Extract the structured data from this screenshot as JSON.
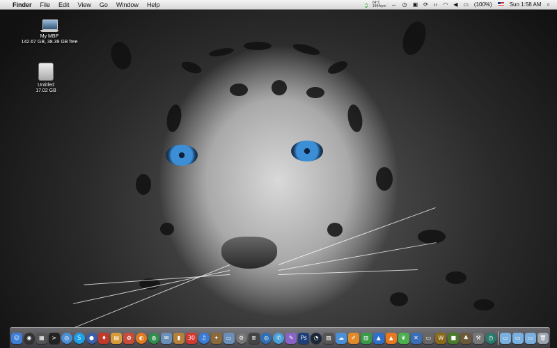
{
  "menubar": {
    "apple_glyph": "",
    "app_name": "Finder",
    "menus": [
      "File",
      "Edit",
      "View",
      "Go",
      "Window",
      "Help"
    ],
    "temperature": "64°C",
    "fan_speed": "1994rpm",
    "battery": "(100%)",
    "clock": "Sun 1:58 AM"
  },
  "desktop_icons": [
    {
      "name": "My MBP",
      "detail": "142.67 GB, 38.39 GB free",
      "icon": "laptop-icon"
    },
    {
      "name": "Untitled",
      "detail": "17.02 GB",
      "icon": "hard-drive-icon"
    }
  ],
  "dock": {
    "items": [
      {
        "icon": "finder-icon",
        "glyph": "☺",
        "color": "#3d7fd6"
      },
      {
        "icon": "dashboard-icon",
        "glyph": "◉",
        "color": "#333333",
        "round": true
      },
      {
        "icon": "mission-control-icon",
        "glyph": "▦",
        "color": "#555555"
      },
      {
        "icon": "terminal-icon",
        "glyph": ">",
        "color": "#222222"
      },
      {
        "icon": "safari-icon",
        "glyph": "◎",
        "color": "#4a8fd6",
        "round": true
      },
      {
        "icon": "skype-icon",
        "glyph": "S",
        "color": "#1ea0e8",
        "round": true
      },
      {
        "icon": "network-icon",
        "glyph": "●",
        "color": "#3a5fa8",
        "round": true
      },
      {
        "icon": "app-store-icon",
        "glyph": "♦",
        "color": "#c0392b"
      },
      {
        "icon": "preview-icon",
        "glyph": "▤",
        "color": "#d89b3a"
      },
      {
        "icon": "photos-icon",
        "glyph": "✿",
        "color": "#c94c3a"
      },
      {
        "icon": "firefox-icon",
        "glyph": "◐",
        "color": "#e37a1f",
        "round": true
      },
      {
        "icon": "chrome-icon",
        "glyph": "◍",
        "color": "#2f8f4e",
        "round": true
      },
      {
        "icon": "mail-icon",
        "glyph": "✉",
        "color": "#6a8fb8"
      },
      {
        "icon": "addressbook-icon",
        "glyph": "▮",
        "color": "#b5803a"
      },
      {
        "icon": "calendar-icon",
        "glyph": "30",
        "color": "#d33a2f"
      },
      {
        "icon": "itunes-icon",
        "glyph": "♫",
        "color": "#3a7bd5",
        "round": true
      },
      {
        "icon": "iphoto-icon",
        "glyph": "✦",
        "color": "#8a6a3a"
      },
      {
        "icon": "folder-icon",
        "glyph": "▭",
        "color": "#6a8fb8"
      },
      {
        "icon": "settings-icon",
        "glyph": "⚙",
        "color": "#777777",
        "round": true
      },
      {
        "icon": "activity-icon",
        "glyph": "≣",
        "color": "#444444"
      },
      {
        "icon": "globe-icon",
        "glyph": "◎",
        "color": "#2d6fb5",
        "round": true
      },
      {
        "icon": "chat-icon",
        "glyph": "✆",
        "color": "#4aa0d8",
        "round": true
      },
      {
        "icon": "paint-icon",
        "glyph": "✎",
        "color": "#8a63c9"
      },
      {
        "icon": "photoshop-icon",
        "glyph": "Ps",
        "color": "#1f3f7a"
      },
      {
        "icon": "steam-icon",
        "glyph": "◔",
        "color": "#1b2838",
        "round": true
      },
      {
        "icon": "image-icon",
        "glyph": "▨",
        "color": "#555555"
      },
      {
        "icon": "cloud-icon",
        "glyph": "☁",
        "color": "#4a90d9"
      },
      {
        "icon": "pages-icon",
        "glyph": "✐",
        "color": "#e08a2a"
      },
      {
        "icon": "numbers-icon",
        "glyph": "▥",
        "color": "#3a9a4a"
      },
      {
        "icon": "keynote-icon",
        "glyph": "▲",
        "color": "#2f6fc9"
      },
      {
        "icon": "vlc-icon",
        "glyph": "▲",
        "color": "#e8781f"
      },
      {
        "icon": "leaf-icon",
        "glyph": "❦",
        "color": "#4caf50"
      },
      {
        "icon": "xcode-icon",
        "glyph": "✕",
        "color": "#3a6fb5"
      },
      {
        "icon": "battery-app-icon",
        "glyph": "▭",
        "color": "#666666"
      },
      {
        "icon": "warcraft-icon",
        "glyph": "W",
        "color": "#8a6a1a"
      },
      {
        "icon": "minecraft-icon",
        "glyph": "■",
        "color": "#4a7a2a"
      },
      {
        "icon": "game-icon",
        "glyph": "♣",
        "color": "#6a5a3a"
      },
      {
        "icon": "tools-icon",
        "glyph": "⚒",
        "color": "#777777"
      },
      {
        "icon": "time-machine-icon",
        "glyph": "◷",
        "color": "#2a7a6a",
        "round": true
      },
      {
        "icon": "separator",
        "sep": true
      },
      {
        "icon": "applications-folder-icon",
        "glyph": "▭",
        "color": "#7ab0e0"
      },
      {
        "icon": "documents-folder-icon",
        "glyph": "▭",
        "color": "#7ab0e0"
      },
      {
        "icon": "downloads-folder-icon",
        "glyph": "▭",
        "color": "#7ab0e0"
      },
      {
        "icon": "trash-icon",
        "glyph": "🗑",
        "color": "#9aa5b0"
      }
    ]
  }
}
